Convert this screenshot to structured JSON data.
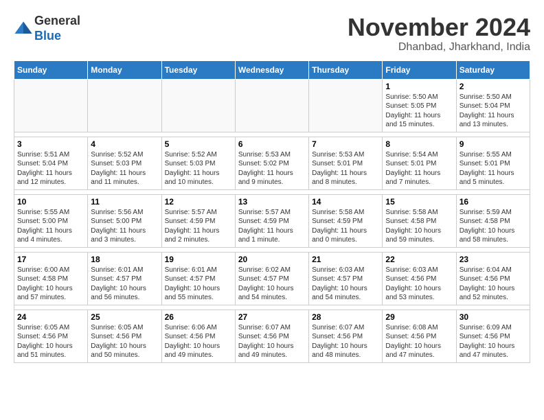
{
  "header": {
    "logo_line1": "General",
    "logo_line2": "Blue",
    "month": "November 2024",
    "location": "Dhanbad, Jharkhand, India"
  },
  "weekdays": [
    "Sunday",
    "Monday",
    "Tuesday",
    "Wednesday",
    "Thursday",
    "Friday",
    "Saturday"
  ],
  "weeks": [
    [
      {
        "day": "",
        "info": ""
      },
      {
        "day": "",
        "info": ""
      },
      {
        "day": "",
        "info": ""
      },
      {
        "day": "",
        "info": ""
      },
      {
        "day": "",
        "info": ""
      },
      {
        "day": "1",
        "info": "Sunrise: 5:50 AM\nSunset: 5:05 PM\nDaylight: 11 hours and 15 minutes."
      },
      {
        "day": "2",
        "info": "Sunrise: 5:50 AM\nSunset: 5:04 PM\nDaylight: 11 hours and 13 minutes."
      }
    ],
    [
      {
        "day": "3",
        "info": "Sunrise: 5:51 AM\nSunset: 5:04 PM\nDaylight: 11 hours and 12 minutes."
      },
      {
        "day": "4",
        "info": "Sunrise: 5:52 AM\nSunset: 5:03 PM\nDaylight: 11 hours and 11 minutes."
      },
      {
        "day": "5",
        "info": "Sunrise: 5:52 AM\nSunset: 5:03 PM\nDaylight: 11 hours and 10 minutes."
      },
      {
        "day": "6",
        "info": "Sunrise: 5:53 AM\nSunset: 5:02 PM\nDaylight: 11 hours and 9 minutes."
      },
      {
        "day": "7",
        "info": "Sunrise: 5:53 AM\nSunset: 5:01 PM\nDaylight: 11 hours and 8 minutes."
      },
      {
        "day": "8",
        "info": "Sunrise: 5:54 AM\nSunset: 5:01 PM\nDaylight: 11 hours and 7 minutes."
      },
      {
        "day": "9",
        "info": "Sunrise: 5:55 AM\nSunset: 5:01 PM\nDaylight: 11 hours and 5 minutes."
      }
    ],
    [
      {
        "day": "10",
        "info": "Sunrise: 5:55 AM\nSunset: 5:00 PM\nDaylight: 11 hours and 4 minutes."
      },
      {
        "day": "11",
        "info": "Sunrise: 5:56 AM\nSunset: 5:00 PM\nDaylight: 11 hours and 3 minutes."
      },
      {
        "day": "12",
        "info": "Sunrise: 5:57 AM\nSunset: 4:59 PM\nDaylight: 11 hours and 2 minutes."
      },
      {
        "day": "13",
        "info": "Sunrise: 5:57 AM\nSunset: 4:59 PM\nDaylight: 11 hours and 1 minute."
      },
      {
        "day": "14",
        "info": "Sunrise: 5:58 AM\nSunset: 4:59 PM\nDaylight: 11 hours and 0 minutes."
      },
      {
        "day": "15",
        "info": "Sunrise: 5:58 AM\nSunset: 4:58 PM\nDaylight: 10 hours and 59 minutes."
      },
      {
        "day": "16",
        "info": "Sunrise: 5:59 AM\nSunset: 4:58 PM\nDaylight: 10 hours and 58 minutes."
      }
    ],
    [
      {
        "day": "17",
        "info": "Sunrise: 6:00 AM\nSunset: 4:58 PM\nDaylight: 10 hours and 57 minutes."
      },
      {
        "day": "18",
        "info": "Sunrise: 6:01 AM\nSunset: 4:57 PM\nDaylight: 10 hours and 56 minutes."
      },
      {
        "day": "19",
        "info": "Sunrise: 6:01 AM\nSunset: 4:57 PM\nDaylight: 10 hours and 55 minutes."
      },
      {
        "day": "20",
        "info": "Sunrise: 6:02 AM\nSunset: 4:57 PM\nDaylight: 10 hours and 54 minutes."
      },
      {
        "day": "21",
        "info": "Sunrise: 6:03 AM\nSunset: 4:57 PM\nDaylight: 10 hours and 54 minutes."
      },
      {
        "day": "22",
        "info": "Sunrise: 6:03 AM\nSunset: 4:56 PM\nDaylight: 10 hours and 53 minutes."
      },
      {
        "day": "23",
        "info": "Sunrise: 6:04 AM\nSunset: 4:56 PM\nDaylight: 10 hours and 52 minutes."
      }
    ],
    [
      {
        "day": "24",
        "info": "Sunrise: 6:05 AM\nSunset: 4:56 PM\nDaylight: 10 hours and 51 minutes."
      },
      {
        "day": "25",
        "info": "Sunrise: 6:05 AM\nSunset: 4:56 PM\nDaylight: 10 hours and 50 minutes."
      },
      {
        "day": "26",
        "info": "Sunrise: 6:06 AM\nSunset: 4:56 PM\nDaylight: 10 hours and 49 minutes."
      },
      {
        "day": "27",
        "info": "Sunrise: 6:07 AM\nSunset: 4:56 PM\nDaylight: 10 hours and 49 minutes."
      },
      {
        "day": "28",
        "info": "Sunrise: 6:07 AM\nSunset: 4:56 PM\nDaylight: 10 hours and 48 minutes."
      },
      {
        "day": "29",
        "info": "Sunrise: 6:08 AM\nSunset: 4:56 PM\nDaylight: 10 hours and 47 minutes."
      },
      {
        "day": "30",
        "info": "Sunrise: 6:09 AM\nSunset: 4:56 PM\nDaylight: 10 hours and 47 minutes."
      }
    ]
  ]
}
